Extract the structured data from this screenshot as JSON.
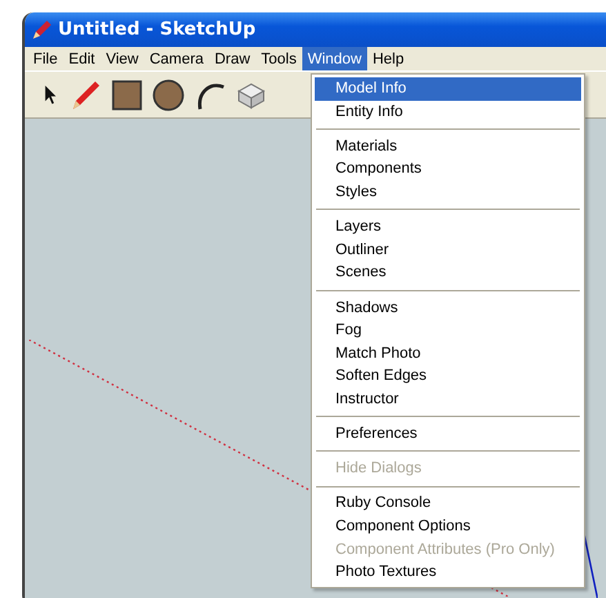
{
  "window": {
    "title": "Untitled - SketchUp"
  },
  "menu_bar": [
    {
      "label": "File",
      "selected": false
    },
    {
      "label": "Edit",
      "selected": false
    },
    {
      "label": "View",
      "selected": false
    },
    {
      "label": "Camera",
      "selected": false
    },
    {
      "label": "Draw",
      "selected": false
    },
    {
      "label": "Tools",
      "selected": false
    },
    {
      "label": "Window",
      "selected": true
    },
    {
      "label": "Help",
      "selected": false
    }
  ],
  "window_menu": [
    [
      {
        "label": "Model Info",
        "selected": true,
        "disabled": false
      },
      {
        "label": "Entity Info",
        "selected": false,
        "disabled": false
      }
    ],
    [
      {
        "label": "Materials",
        "selected": false,
        "disabled": false
      },
      {
        "label": "Components",
        "selected": false,
        "disabled": false
      },
      {
        "label": "Styles",
        "selected": false,
        "disabled": false
      }
    ],
    [
      {
        "label": "Layers",
        "selected": false,
        "disabled": false
      },
      {
        "label": "Outliner",
        "selected": false,
        "disabled": false
      },
      {
        "label": "Scenes",
        "selected": false,
        "disabled": false
      }
    ],
    [
      {
        "label": "Shadows",
        "selected": false,
        "disabled": false
      },
      {
        "label": "Fog",
        "selected": false,
        "disabled": false
      },
      {
        "label": "Match Photo",
        "selected": false,
        "disabled": false
      },
      {
        "label": "Soften Edges",
        "selected": false,
        "disabled": false
      },
      {
        "label": "Instructor",
        "selected": false,
        "disabled": false
      }
    ],
    [
      {
        "label": "Preferences",
        "selected": false,
        "disabled": false
      }
    ],
    [
      {
        "label": "Hide Dialogs",
        "selected": false,
        "disabled": true
      }
    ],
    [
      {
        "label": "Ruby Console",
        "selected": false,
        "disabled": false
      },
      {
        "label": "Component Options",
        "selected": false,
        "disabled": false
      },
      {
        "label": "Component Attributes (Pro Only)",
        "selected": false,
        "disabled": true
      },
      {
        "label": "Photo Textures",
        "selected": false,
        "disabled": false
      }
    ]
  ]
}
